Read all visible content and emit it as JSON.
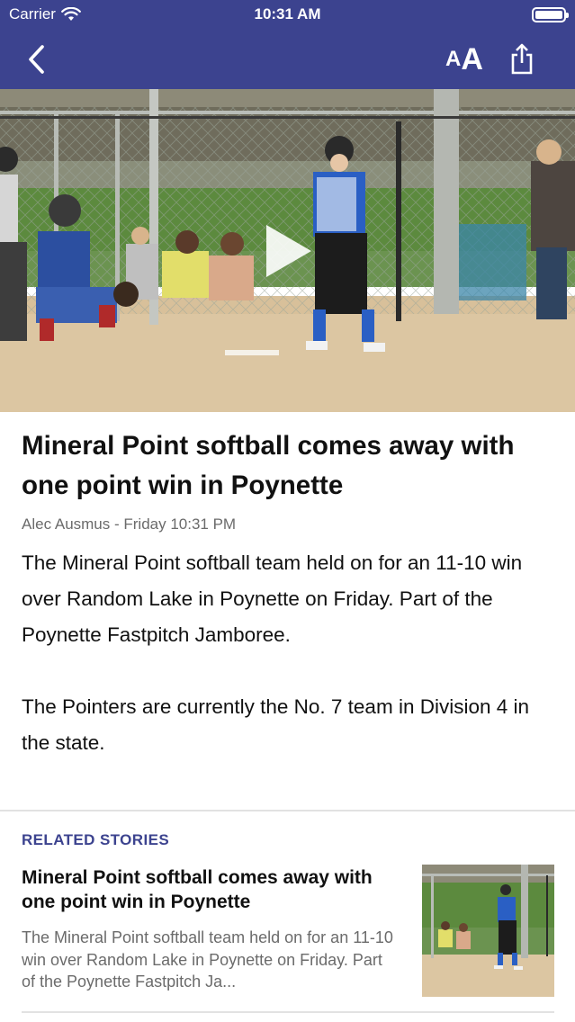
{
  "status_bar": {
    "carrier": "Carrier",
    "time": "10:31 AM",
    "battery_level": 1.0
  },
  "nav": {
    "back_icon": "chevron-left-icon",
    "text_size_small": "A",
    "text_size_large": "A",
    "share_icon": "share-icon",
    "bar_color": "#3c438f"
  },
  "video": {
    "play_icon": "play-icon"
  },
  "article": {
    "headline": "Mineral Point softball comes away with one point win in Poynette",
    "byline": "Alec Ausmus - Friday 10:31 PM",
    "paragraphs": [
      "The Mineral Point softball team held on for an 11-10 win over Random Lake in Poynette on Friday. Part of the Poynette Fastpitch Jamboree.",
      "The Pointers are currently the No. 7 team in Division 4 in the state."
    ]
  },
  "related": {
    "heading": "RELATED STORIES",
    "accent_color": "#3c438f",
    "items": [
      {
        "title": "Mineral Point softball comes away with one point win in Poynette",
        "summary": "The Mineral Point softball team held on for an 11-10 win over Random Lake in Poynette on Friday. Part of the Poynette Fastpitch Ja..."
      }
    ]
  }
}
